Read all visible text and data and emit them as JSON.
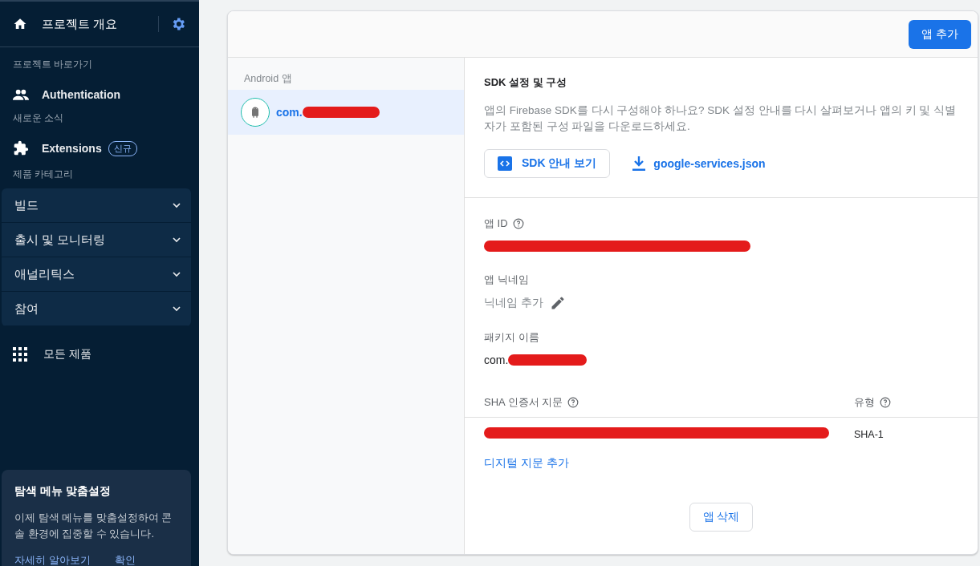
{
  "sidebar": {
    "project_title": "프로젝트 개요",
    "shortcuts_label": "프로젝트 바로가기",
    "shortcut": {
      "label": "Authentication"
    },
    "news_label": "새로운 소식",
    "news_item": {
      "label": "Extensions",
      "badge": "신규"
    },
    "categories_label": "제품 카테고리",
    "categories": [
      {
        "label": "빌드",
        "expanded": false
      },
      {
        "label": "출시 및 모니터링",
        "expanded": false
      },
      {
        "label": "애널리틱스",
        "expanded": false
      },
      {
        "label": "참여",
        "expanded": false
      }
    ],
    "all_products": "모든 제품",
    "promo": {
      "title": "탐색 메뉴 맞춤설정",
      "text": "이제 탐색 메뉴를 맞춤설정하여 콘솔 환경에 집중할 수 있습니다.",
      "links": [
        "자세히 알아보기",
        "확인"
      ]
    }
  },
  "main": {
    "add_app_button": "앱 추가",
    "apps": {
      "heading": "Android 앱",
      "items": [
        {
          "name": "com.",
          "selected": true
        }
      ]
    },
    "sdk": {
      "title": "SDK 설정 및 구성",
      "description": "앱의 Firebase SDK를 다시 구성해야 하나요? SDK 설정 안내를 다시 살펴보거나 앱의 키 및 식별자가 포함된 구성 파일을 다운로드하세요.",
      "guide_button": "SDK 안내 보기",
      "download_link": "google-services.json"
    },
    "app_id": {
      "label": "앱 ID"
    },
    "nickname": {
      "label": "앱 닉네임",
      "add_text": "닉네임 추가"
    },
    "package": {
      "label": "패키지 이름",
      "value": "com."
    },
    "sha_table": {
      "columns": [
        "SHA 인증서 지문",
        "유형"
      ],
      "rows": [
        {
          "type": "SHA-1"
        }
      ]
    },
    "add_fingerprint_link": "디지털 지문 추가",
    "delete_button": "앱 삭제"
  }
}
